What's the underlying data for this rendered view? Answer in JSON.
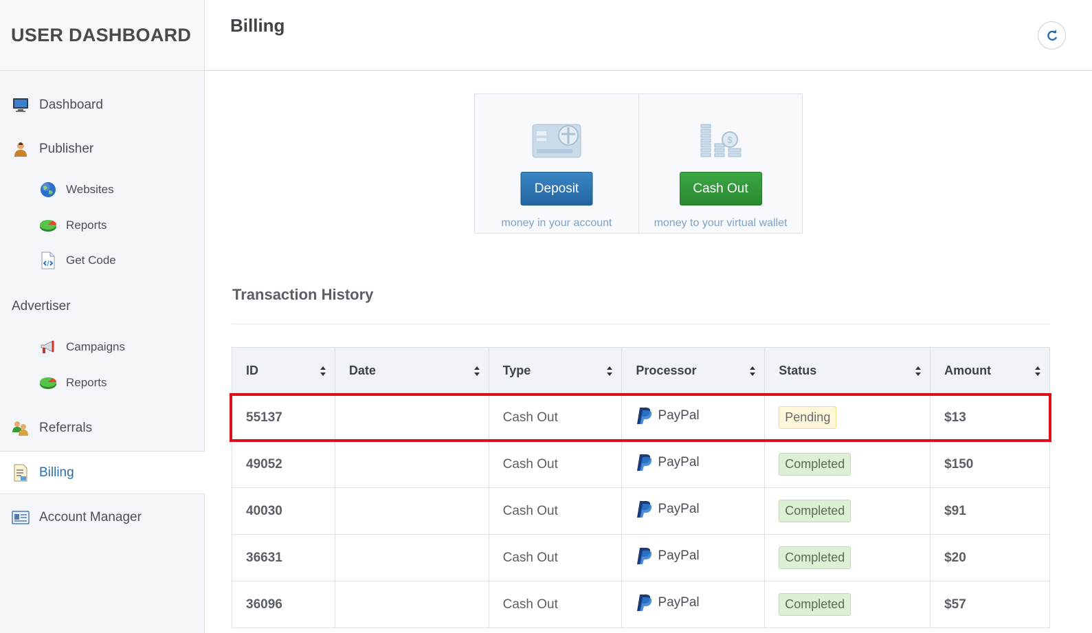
{
  "sidebar": {
    "brand": "USER DASHBOARD",
    "items": {
      "dashboard": "Dashboard",
      "publisher": "Publisher",
      "websites": "Websites",
      "pub_reports": "Reports",
      "get_code": "Get Code",
      "advertiser": "Advertiser",
      "campaigns": "Campaigns",
      "adv_reports": "Reports",
      "referrals": "Referrals",
      "billing": "Billing",
      "account_manager": "Account Manager"
    },
    "active_item": "billing"
  },
  "header": {
    "title": "Billing",
    "refresh_icon": "refresh-icon"
  },
  "actions": {
    "deposit": {
      "label": "Deposit",
      "caption": "money in your account",
      "icon": "credit-card-icon",
      "color": "#2a6ea9"
    },
    "cashout": {
      "label": "Cash Out",
      "caption": "money to your virtual wallet",
      "icon": "coins-icon",
      "color": "#2f9537"
    }
  },
  "history": {
    "title": "Transaction History",
    "columns": {
      "id": "ID",
      "date": "Date",
      "type": "Type",
      "processor": "Processor",
      "status": "Status",
      "amount": "Amount"
    },
    "rows": [
      {
        "id": "55137",
        "date": "",
        "type": "Cash Out",
        "processor": "PayPal",
        "status": "Pending",
        "amount": "$13"
      },
      {
        "id": "49052",
        "date": "",
        "type": "Cash Out",
        "processor": "PayPal",
        "status": "Completed",
        "amount": "$150"
      },
      {
        "id": "40030",
        "date": "",
        "type": "Cash Out",
        "processor": "PayPal",
        "status": "Completed",
        "amount": "$91"
      },
      {
        "id": "36631",
        "date": "",
        "type": "Cash Out",
        "processor": "PayPal",
        "status": "Completed",
        "amount": "$20"
      },
      {
        "id": "36096",
        "date": "",
        "type": "Cash Out",
        "processor": "PayPal",
        "status": "Completed",
        "amount": "$57"
      }
    ],
    "highlighted_row": 0
  },
  "colors": {
    "highlight": "#e0101a",
    "pending": "#fdf6d8",
    "completed": "#ddf0d4",
    "link_active": "#2d6ea8"
  }
}
